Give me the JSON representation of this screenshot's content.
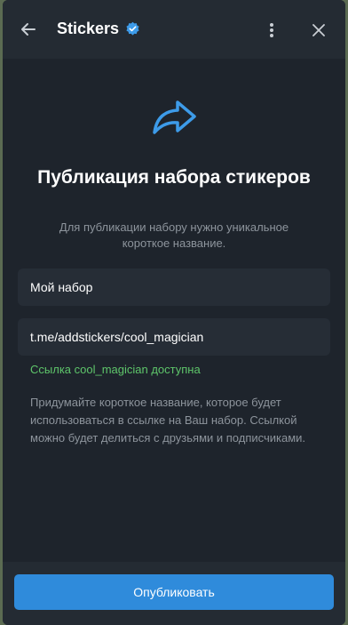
{
  "header": {
    "title": "Stickers",
    "back_icon": "arrow-left-icon",
    "verified_icon": "verified-badge-icon",
    "more_icon": "more-vertical-icon",
    "close_icon": "close-icon"
  },
  "main": {
    "icon": "share-arrow-icon",
    "heading": "Публикация набора стикеров",
    "subtitle": "Для публикации набору нужно уникальное короткое название.",
    "name_field": {
      "value": "Мой набор"
    },
    "link_field": {
      "value": "t.me/addstickers/cool_magician"
    },
    "status": "Ссылка cool_magician доступна",
    "hint": "Придумайте короткое название, которое будет использоваться в ссылке на Ваш набор. Ссылкой можно будет делиться с друзьями и подписчиками."
  },
  "footer": {
    "publish_label": "Опубликовать"
  },
  "colors": {
    "accent": "#2f8bdb",
    "success": "#5ec56a",
    "background": "#1e242c"
  }
}
